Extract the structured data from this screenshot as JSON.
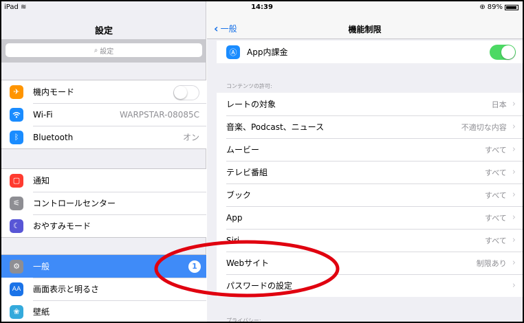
{
  "status": {
    "device": "iPad",
    "time": "14:39",
    "battery": "89%"
  },
  "master": {
    "title": "設定",
    "search_placeholder": "設定",
    "group1": [
      {
        "icon": "airplane-icon",
        "label": "機内モード",
        "color": "#ff9500"
      },
      {
        "icon": "wifi-icon",
        "label": "Wi-Fi",
        "value": "WARPSTAR-08085C",
        "color": "#1a8cff"
      },
      {
        "icon": "bluetooth-icon",
        "label": "Bluetooth",
        "value": "オン",
        "color": "#1a8cff"
      }
    ],
    "group2": [
      {
        "icon": "notifications-icon",
        "label": "通知",
        "color": "#ff3b30"
      },
      {
        "icon": "control-center-icon",
        "label": "コントロールセンター",
        "color": "#8e8e93"
      },
      {
        "icon": "do-not-disturb-icon",
        "label": "おやすみモード",
        "color": "#5856d6"
      }
    ],
    "group3": [
      {
        "icon": "gear-icon",
        "label": "一般",
        "badge": "1",
        "color": "#8e8e93"
      },
      {
        "icon": "display-brightness-icon",
        "label": "画面表示と明るさ",
        "color": "#1a73e8"
      },
      {
        "icon": "wallpaper-icon",
        "label": "壁紙",
        "color": "#34aadc"
      }
    ]
  },
  "detail": {
    "back_label": "一般",
    "title": "機能制限",
    "in_app_purchase": {
      "label": "App内課金"
    },
    "content_header": "コンテンツの許可:",
    "rows": [
      {
        "label": "レートの対象",
        "value": "日本"
      },
      {
        "label": "音楽、Podcast、ニュース",
        "value": "不適切な内容"
      },
      {
        "label": "ムービー",
        "value": "すべて"
      },
      {
        "label": "テレビ番組",
        "value": "すべて"
      },
      {
        "label": "ブック",
        "value": "すべて"
      },
      {
        "label": "App",
        "value": "すべて"
      },
      {
        "label": "Siri",
        "value": "すべて"
      },
      {
        "label": "Webサイト",
        "value": "制限あり"
      },
      {
        "label": "パスワードの設定",
        "value": ""
      }
    ],
    "privacy_header": "プライバシー:"
  },
  "annotation": {
    "color": "#e0000f"
  }
}
